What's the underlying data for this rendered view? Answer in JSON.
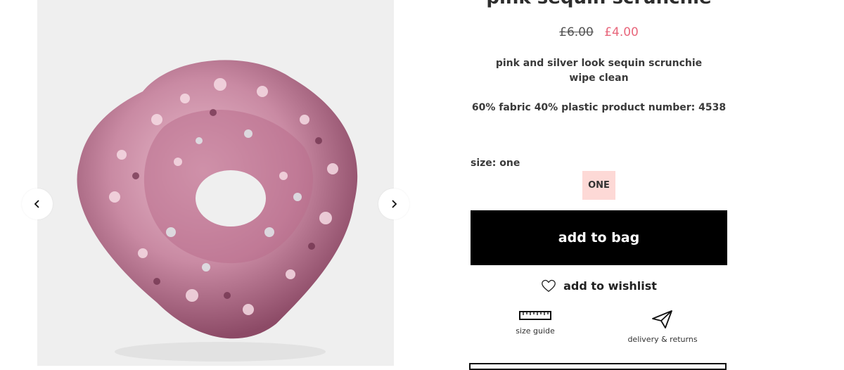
{
  "product": {
    "title": "pink sequin scrunchie",
    "price_old": "£6.00",
    "price_new": "£4.00",
    "description_line1": "pink and silver look sequin scrunchie",
    "description_line2": "wipe clean",
    "composition": "60% fabric 40% plastic product number: 4538",
    "size_label": "size: one",
    "size_option": "ONE"
  },
  "actions": {
    "add_to_bag": "add to bag",
    "add_to_wishlist": "add to wishlist",
    "size_guide": "size guide",
    "delivery_returns": "delivery & returns"
  },
  "icons": {
    "prev": "chevron-left-icon",
    "next": "chevron-right-icon",
    "wishlist": "heart-icon",
    "size_guide": "ruler-icon",
    "delivery": "paper-plane-icon"
  },
  "colors": {
    "sale_price": "#e8677c",
    "size_chip_bg": "#fdd9d6",
    "primary_button": "#000000",
    "gallery_bg": "#efefef"
  }
}
